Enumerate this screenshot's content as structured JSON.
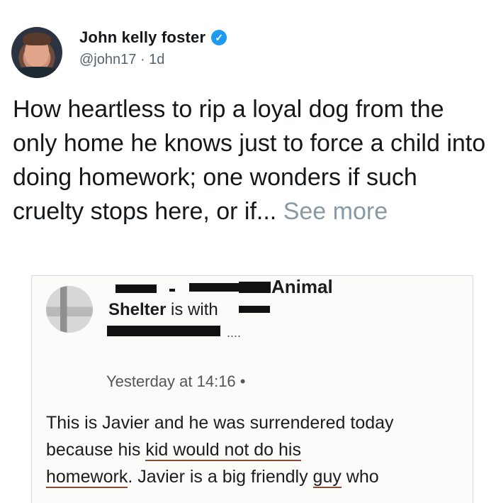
{
  "tweet": {
    "author_name": "John kelly foster",
    "handle": "@john17",
    "separator": "·",
    "time": "1d",
    "text": "How heartless to rip a loyal dog from the only home he knows just to force a child into doing homework; one wonders if such cruelty stops here, or if...",
    "see_more": "See more",
    "verified_icon": "verified-icon"
  },
  "embedded_post": {
    "title_line1": "Animal",
    "title_line2_bold": "Shelter",
    "title_line2_rest": " is with",
    "ellipsis": "....",
    "timestamp": "Yesterday at 14:16 •",
    "body_line1": "This is Javier and he was surrendered today",
    "body_line2_part1": "because his ",
    "body_line2_underlined": "kid would not do his",
    "body_line3_underlined": "homework",
    "body_line3_part2": ". Javier is a big friendly ",
    "body_line3_underlined2": "guy",
    "body_line3_part3": " who"
  }
}
